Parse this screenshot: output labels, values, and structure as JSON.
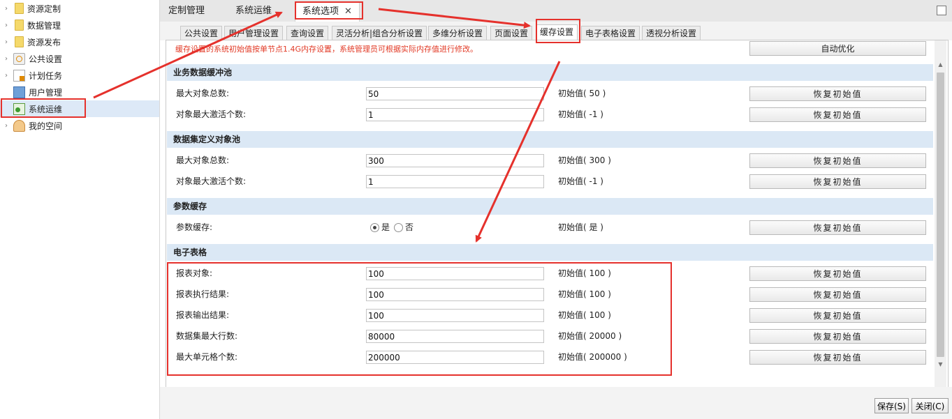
{
  "sidebar": {
    "items": [
      {
        "label": "资源定制",
        "icon": "folder-icon",
        "arrow": "›"
      },
      {
        "label": "数据管理",
        "icon": "folder-icon",
        "arrow": "›"
      },
      {
        "label": "资源发布",
        "icon": "folder-icon",
        "arrow": "›"
      },
      {
        "label": "公共设置",
        "icon": "settings-icon",
        "arrow": "›"
      },
      {
        "label": "计划任务",
        "icon": "schedule-task-icon",
        "arrow": "›"
      },
      {
        "label": "用户管理",
        "icon": "user-management-icon",
        "arrow": ""
      },
      {
        "label": "系统运维",
        "icon": "system-ops-icon",
        "arrow": ""
      },
      {
        "label": "我的空间",
        "icon": "person-icon",
        "arrow": "›"
      }
    ]
  },
  "top_tabs": [
    {
      "label": "定制管理"
    },
    {
      "label": "系统运维"
    },
    {
      "label": "系统选项",
      "close": "✕"
    }
  ],
  "sub_tabs": [
    {
      "label": "公共设置"
    },
    {
      "label": "用户管理设置"
    },
    {
      "label": "查询设置"
    },
    {
      "label": "灵活分析|组合分析设置"
    },
    {
      "label": "多维分析设置"
    },
    {
      "label": "页面设置"
    },
    {
      "label": "缓存设置"
    },
    {
      "label": "电子表格设置"
    },
    {
      "label": "透视分析设置"
    }
  ],
  "notice": "缓存设置的系统初始值按单节点1.4G内存设置，系统管理员可根据实际内存值进行修改。",
  "auto_optimize_label": "自动优化",
  "restore_label": "恢复初始值",
  "sections": {
    "business_pool": {
      "title": "业务数据缓冲池",
      "rows": [
        {
          "label": "最大对象总数:",
          "value": "50",
          "initial": "初始值( 50 )"
        },
        {
          "label": "对象最大激活个数:",
          "value": "1",
          "initial": "初始值( -1 )"
        }
      ]
    },
    "dataset_pool": {
      "title": "数据集定义对象池",
      "rows": [
        {
          "label": "最大对象总数:",
          "value": "300",
          "initial": "初始值( 300 )"
        },
        {
          "label": "对象最大激活个数:",
          "value": "1",
          "initial": "初始值( -1 )"
        }
      ]
    },
    "param_cache": {
      "title": "参数缓存",
      "label": "参数缓存:",
      "option_yes": "是",
      "option_no": "否",
      "selected": "是",
      "initial": "初始值( 是 )"
    },
    "spreadsheet": {
      "title": "电子表格",
      "rows": [
        {
          "label": "报表对象:",
          "value": "100",
          "initial": "初始值( 100 )"
        },
        {
          "label": "报表执行结果:",
          "value": "100",
          "initial": "初始值( 100 )"
        },
        {
          "label": "报表输出结果:",
          "value": "100",
          "initial": "初始值( 100 )"
        },
        {
          "label": "数据集最大行数:",
          "value": "80000",
          "initial": "初始值( 20000 )"
        },
        {
          "label": "最大单元格个数:",
          "value": "200000",
          "initial": "初始值( 200000 )"
        }
      ]
    }
  },
  "footer": {
    "save_label": "保存(S)",
    "close_label": "关闭(C)"
  },
  "annotation_color": "#e5312c"
}
